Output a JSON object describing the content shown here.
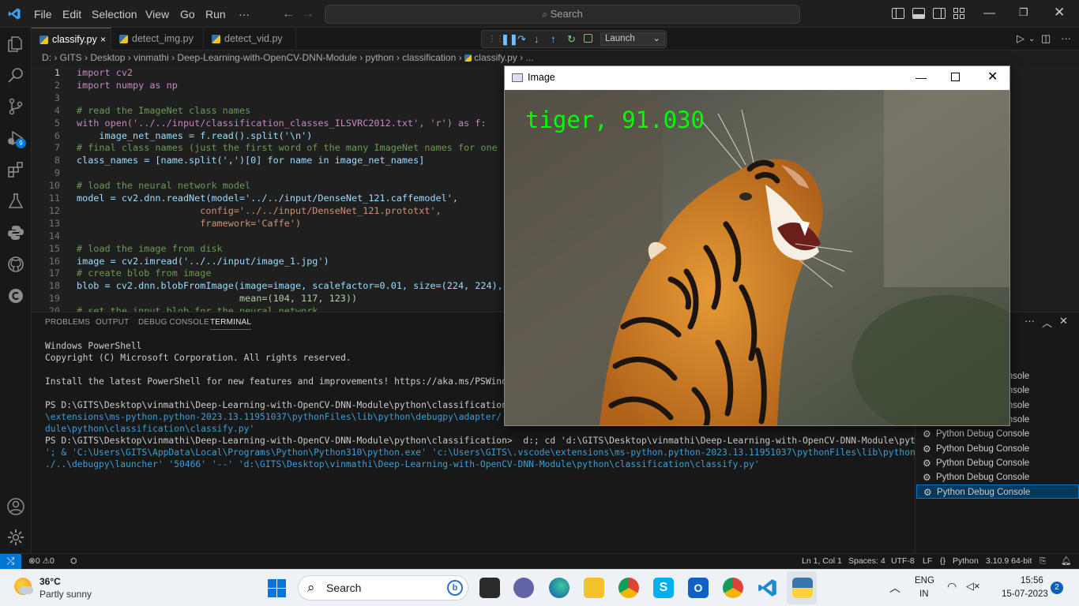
{
  "menu": [
    "File",
    "Edit",
    "Selection",
    "View",
    "Go",
    "Run",
    "···"
  ],
  "search": {
    "label": "Search"
  },
  "tabs": [
    {
      "label": "classify.py",
      "active": true,
      "close": "×"
    },
    {
      "label": "detect_img.py"
    },
    {
      "label": "detect_vid.py"
    }
  ],
  "debug": {
    "config": "Launch"
  },
  "breadcrumb": [
    "D:",
    "GITS",
    "Desktop",
    "vinmathi",
    "Deep-Learning-with-OpenCV-DNN-Module",
    "python",
    "classification",
    "classify.py",
    "..."
  ],
  "editor": {
    "line_numbers": [
      "1",
      "2",
      "3",
      "4",
      "5",
      "6",
      "7",
      "8",
      "9",
      "10",
      "11",
      "12",
      "13",
      "14",
      "15",
      "16",
      "17",
      "18",
      "19",
      "20"
    ],
    "lines": [
      "import cv2",
      "import numpy as np",
      "",
      "# read the ImageNet class names",
      "with open('../../input/classification_classes_ILSVRC2012.txt', 'r') as f:",
      "    image_net_names = f.read().split('\\n')",
      "# final class names (just the first word of the many ImageNet names for one image)",
      "class_names = [name.split(',')[0] for name in image_net_names]",
      "",
      "# load the neural network model",
      "model = cv2.dnn.readNet(model='../../input/DenseNet_121.caffemodel',",
      "                      config='../../input/DenseNet_121.prototxt',",
      "                      framework='Caffe')",
      "",
      "# load the image from disk",
      "image = cv2.imread('../../input/image_1.jpg')",
      "# create blob from image",
      "blob = cv2.dnn.blobFromImage(image=image, scalefactor=0.01, size=(224, 224),",
      "                             mean=(104, 117, 123))",
      "# set the input blob for the neural network"
    ]
  },
  "panel": {
    "tabs": [
      "PROBLEMS",
      "OUTPUT",
      "DEBUG CONSOLE",
      "TERMINAL"
    ],
    "active_tab": "TERMINAL"
  },
  "terminal": {
    "lines": [
      "Windows PowerShell",
      "Copyright (C) Microsoft Corporation. All rights reserved.",
      "",
      "Install the latest PowerShell for new features and improvements! https://aka.ms/PSWindows",
      "",
      "PS D:\\GITS\\Desktop\\vinmathi\\Deep-Learning-with-OpenCV-DNN-Module\\python\\classification>  & 'C:\\Us",
      "\\extensions\\ms-python.python-2023.13.11951037\\pythonFiles\\lib\\python\\debugpy\\adapter/../..\\debugp",
      "dule\\python\\classification\\classify.py'",
      "PS D:\\GITS\\Desktop\\vinmathi\\Deep-Learning-with-OpenCV-DNN-Module\\python\\classification>  d:; cd 'd:\\GITS\\Desktop\\vinmathi\\Deep-Learning-with-OpenCV-DNN-Module\\python\\classification",
      "'; & 'C:\\Users\\GITS\\AppData\\Local\\Programs\\Python\\Python310\\python.exe' 'c:\\Users\\GITS\\.vscode\\extensions\\ms-python.python-2023.13.11951037\\pythonFiles\\lib\\python\\debugpy\\adapter/.",
      "./..\\debugpy\\launcher' '50466' '--' 'd:\\GITS\\Desktop\\vinmathi\\Deep-Learning-with-OpenCV-DNN-Module\\python\\classification\\classify.py'"
    ]
  },
  "terminal_list": [
    "Python Debug Console",
    "Python Debug Console",
    "Python Debug Console",
    "Python Debug Console",
    "Python Debug Console",
    "Python Debug Console",
    "Python Debug Console",
    "Python Debug Console",
    "Python Debug Console"
  ],
  "terminal_list_partial": [
    "ole",
    "ole",
    "ole",
    "ole",
    "ole"
  ],
  "image_window": {
    "title": "Image",
    "prediction": "tiger, 91.030"
  },
  "status": {
    "errors": "0",
    "warnings": "0",
    "position": "Ln 1, Col 1",
    "spaces": "Spaces: 4",
    "encoding": "UTF-8",
    "eol": "LF",
    "language": "Python",
    "interpreter": "3.10.9 64-bit"
  },
  "taskbar": {
    "temp": "36°C",
    "weather": "Partly sunny",
    "search": "Search",
    "lang1": "ENG",
    "lang2": "IN",
    "time": "15:56",
    "date": "15-07-2023",
    "notif": "2"
  },
  "colors": {
    "accent": "#0078d4",
    "prediction": "#00ff00",
    "activity_badge": "#0078d4"
  }
}
